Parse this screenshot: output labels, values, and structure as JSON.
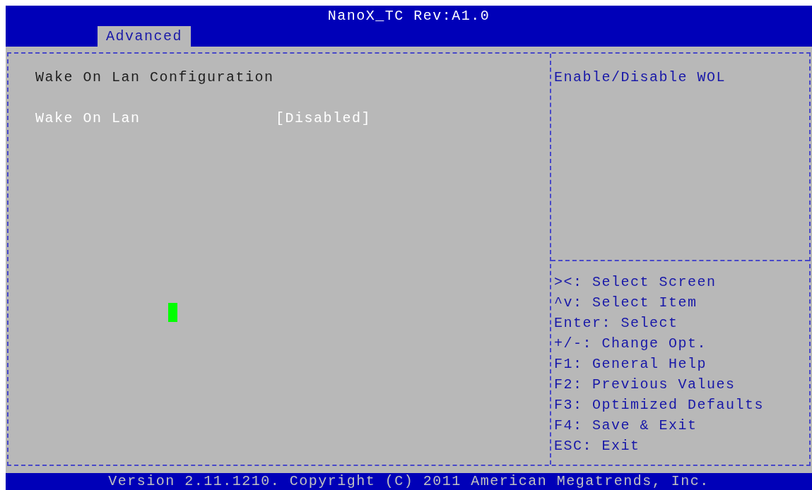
{
  "window": {
    "title": "NanoX_TC Rev:A1.0"
  },
  "tabs": [
    {
      "label": "Advanced",
      "selected": true
    }
  ],
  "section_title": "Wake On Lan Configuration",
  "settings": [
    {
      "label": "Wake On Lan",
      "value": "[Disabled]",
      "selected": true
    }
  ],
  "help_text": "Enable/Disable WOL",
  "key_hints": [
    "><: Select Screen",
    "^v: Select Item",
    "Enter: Select",
    "+/-: Change Opt.",
    "F1: General Help",
    "F2: Previous Values",
    "F3: Optimized Defaults",
    "F4: Save & Exit",
    "ESC: Exit"
  ],
  "status_bar": "Version 2.11.1210. Copyright (C) 2011 American Megatrends, Inc."
}
